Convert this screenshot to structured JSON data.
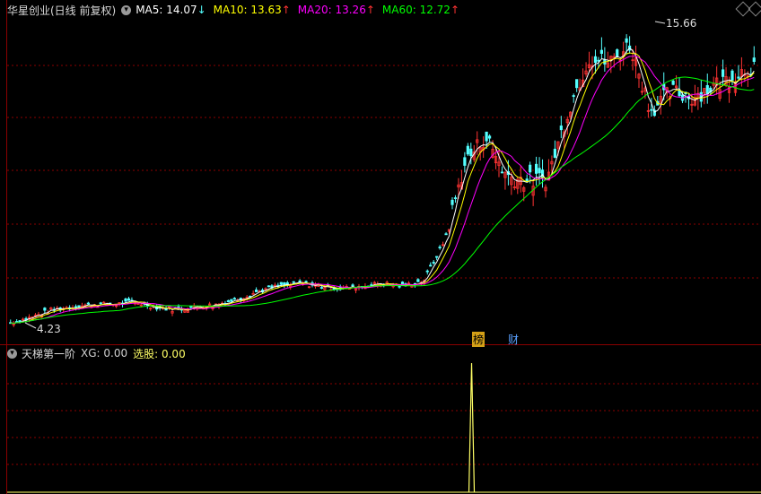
{
  "header": {
    "title": "华星创业(日线 前复权)",
    "ma5_label": "MA5: 14.07",
    "ma5_arrow": "↓",
    "ma10_label": "MA10: 13.63",
    "ma10_arrow": "↑",
    "ma20_label": "MA20: 13.26",
    "ma20_arrow": "↑",
    "ma60_label": "MA60: 12.72",
    "ma60_arrow": "↑"
  },
  "colors": {
    "ma5": "#ffffff",
    "ma10": "#ffff00",
    "ma20": "#ff00ff",
    "ma60": "#00ff00",
    "up": "#ff3333",
    "down": "#54ffff",
    "grid": "#8b0000",
    "indicator": "#ffff66"
  },
  "annotations": {
    "high_label": "15.66",
    "low_label": "4.23",
    "event_bang": "榜",
    "event_cai": "财"
  },
  "indicator": {
    "name": "天梯第一阶",
    "xg_label": "XG: 0.00",
    "xuangu_label": "选股: 0.00"
  },
  "chart_data": {
    "type": "line",
    "price_high": 15.66,
    "price_low": 4.23,
    "series": [
      {
        "name": "MA5",
        "last": 14.07
      },
      {
        "name": "MA10",
        "last": 13.63
      },
      {
        "name": "MA20",
        "last": 13.26
      },
      {
        "name": "MA60",
        "last": 12.72
      }
    ],
    "close_trend": [
      4.4,
      4.6,
      4.9,
      5.0,
      5.1,
      5.1,
      5.2,
      5.0,
      4.9,
      5.0,
      5.1,
      5.3,
      5.6,
      5.8,
      5.9,
      5.8,
      5.7,
      5.8,
      5.9,
      5.8,
      6.0,
      7.5,
      10.5,
      11.5,
      10.0,
      9.8,
      9.9,
      12.5,
      14.5,
      14.3,
      15.0,
      12.5,
      13.2,
      13.0,
      13.4,
      13.8,
      14.2
    ],
    "indicator_signal_index": 0.61
  }
}
